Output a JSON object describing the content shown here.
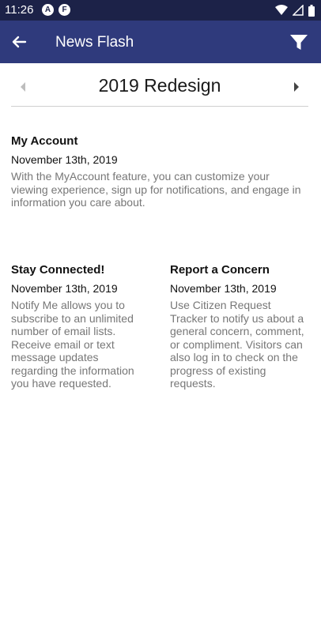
{
  "status": {
    "time": "11:26",
    "badge_a": "A",
    "badge_f": "F"
  },
  "appbar": {
    "title": "News Flash",
    "back_icon": "arrow-back-icon",
    "filter_icon": "filter-icon"
  },
  "pager": {
    "title": "2019 Redesign",
    "prev_icon": "chevron-left-icon",
    "next_icon": "chevron-right-icon"
  },
  "articles": [
    {
      "title": "My Account",
      "date": "November 13th, 2019",
      "body": "With the MyAccount feature, you can customize your viewing experience, sign up for notifications, and engage in information you care about."
    },
    {
      "title": "Stay Connected!",
      "date": "November 13th, 2019",
      "body": "Notify Me allows you to subscribe to an unlimited number of email lists. Receive email or text message updates regarding the information you have requested."
    },
    {
      "title": "Report a Concern",
      "date": "November 13th, 2019",
      "body": "Use Citizen Request Tracker to notify us about a general concern, comment, or compliment. Visitors can also log in to check on the progress of existing requests."
    }
  ],
  "colors": {
    "statusbar": "#1c2248",
    "appbar": "#2f3a7c",
    "body_text": "#777777"
  }
}
